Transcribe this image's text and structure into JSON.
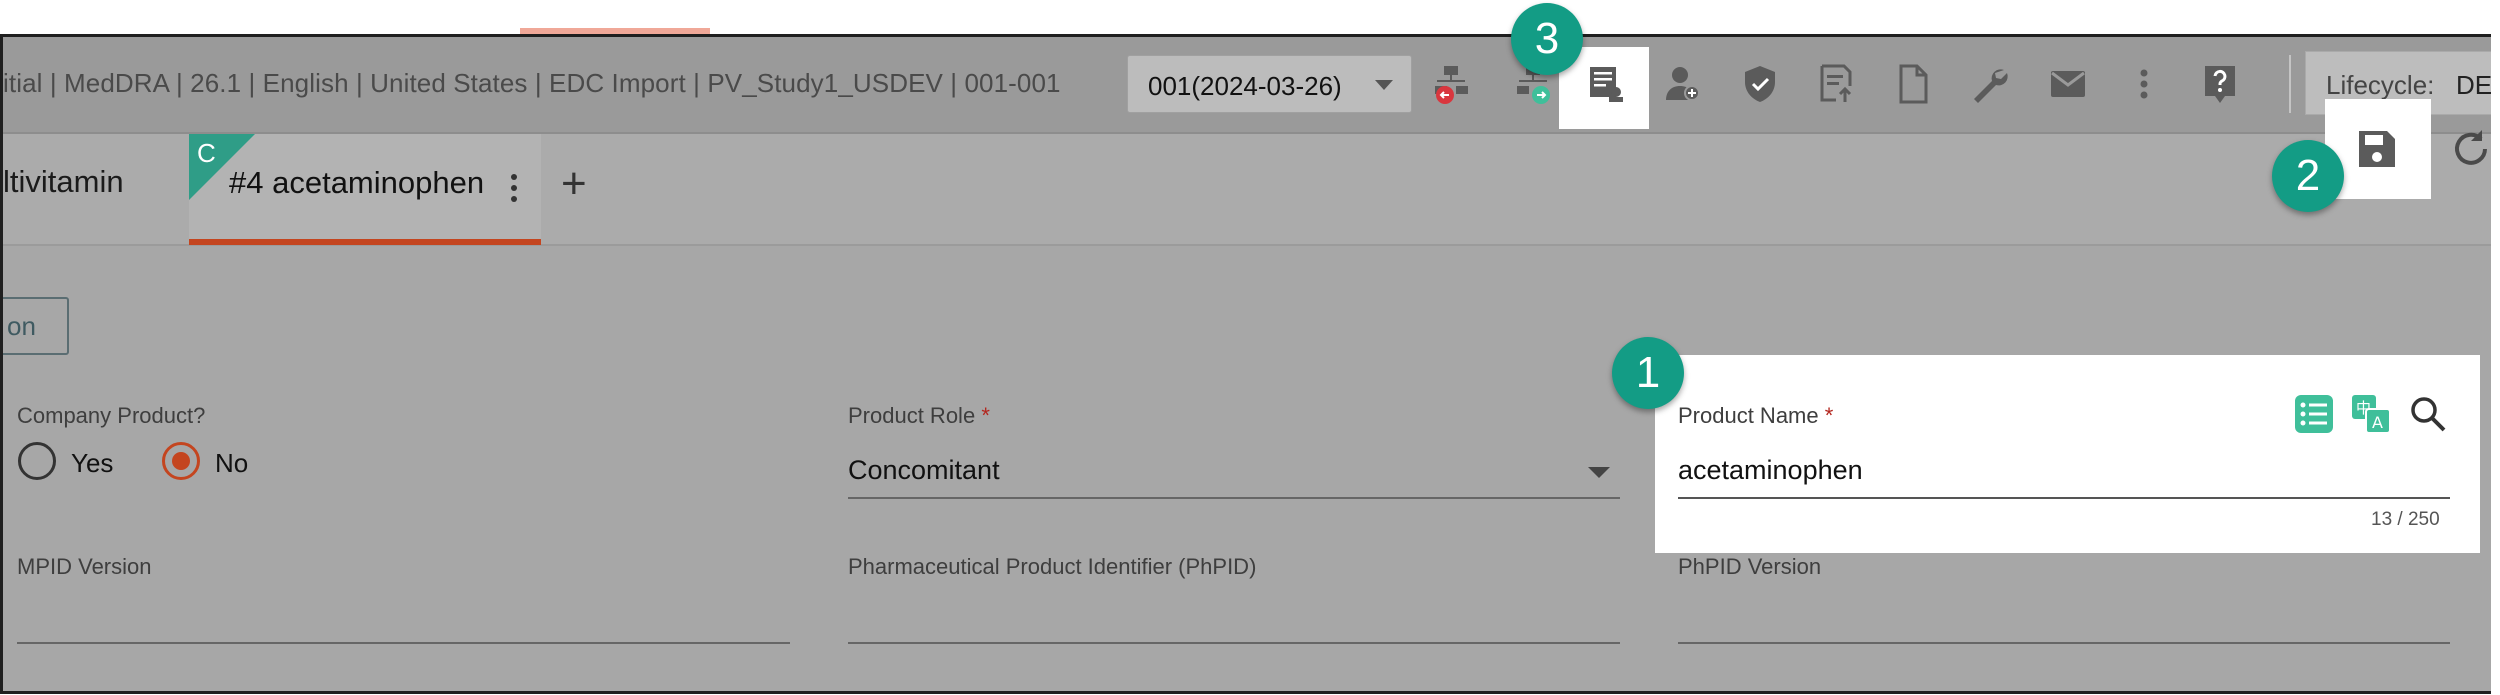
{
  "header": {
    "context_text": "itial | MedDRA | 26.1 | English | United States | EDC Import | PV_Study1_USDEV | 001-001",
    "version_select": "001(2024-03-26)",
    "lifecycle_label": "Lifecycle:",
    "lifecycle_value": "DE"
  },
  "tabs": {
    "prev_label": "ltivitamin",
    "active_label": "#4 acetaminophen",
    "active_corner_letter": "C",
    "add_label": "+"
  },
  "form": {
    "partial_button_label": "on",
    "company_product_label": "Company Product?",
    "yes_label": "Yes",
    "no_label": "No",
    "company_product_selected": "No",
    "product_role_label": "Product Role",
    "product_role_value": "Concomitant",
    "product_name_label": "Product Name",
    "product_name_value": "acetaminophen",
    "product_name_counter": "13 / 250",
    "mpid_version_label": "MPID Version",
    "phpid_label": "Pharmaceutical Product Identifier (PhPID)",
    "phpid_version_label": "PhPID Version",
    "required_marker": "*"
  },
  "annotations": {
    "badge_1": "1",
    "badge_2": "2",
    "badge_3": "3"
  },
  "colors": {
    "accent": "#c4451f",
    "badge": "#139c85",
    "icon_green": "#3fbf9a",
    "icon_red": "#d9363e"
  },
  "icons": [
    "sitemap-back-icon",
    "sitemap-forward-icon",
    "form-user-icon",
    "user-add-icon",
    "shield-check-icon",
    "document-upload-icon",
    "document-icon",
    "wrench-icon",
    "mail-icon",
    "more-vertical-icon",
    "help-icon",
    "save-icon",
    "refresh-icon",
    "list-icon",
    "translate-icon",
    "search-icon"
  ]
}
